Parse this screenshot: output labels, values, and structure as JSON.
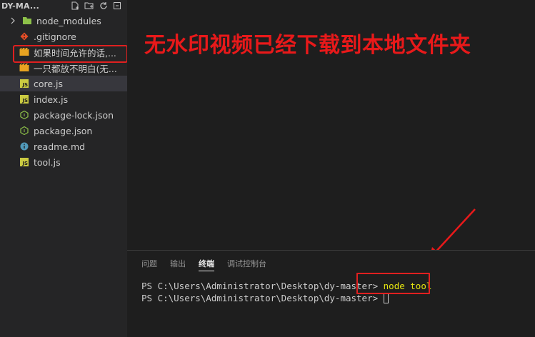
{
  "sidebar": {
    "title": "DY-MA...",
    "items": [
      {
        "label": "node_modules",
        "icon": "folder-icon",
        "type": "folder"
      },
      {
        "label": ".gitignore",
        "icon": "git-icon"
      },
      {
        "label": "如果时间允许的话,...",
        "icon": "video-file-icon"
      },
      {
        "label": "一只都放不明白(无...",
        "icon": "video-file-icon"
      },
      {
        "label": "core.js",
        "icon": "js-file-icon",
        "selected": true
      },
      {
        "label": "index.js",
        "icon": "js-file-icon"
      },
      {
        "label": "package-lock.json",
        "icon": "json-file-icon"
      },
      {
        "label": "package.json",
        "icon": "json-file-icon"
      },
      {
        "label": "readme.md",
        "icon": "info-icon"
      },
      {
        "label": "tool.js",
        "icon": "js-file-icon"
      }
    ]
  },
  "annotation": {
    "headline": "无水印视频已经下载到本地文件夹",
    "color": "#e8191a"
  },
  "panel": {
    "tabs": [
      {
        "label": "问题"
      },
      {
        "label": "输出"
      },
      {
        "label": "终端",
        "active": true
      },
      {
        "label": "调试控制台"
      }
    ],
    "terminal": {
      "prompt1": "PS C:\\Users\\Administrator\\Desktop\\dy-master> ",
      "command1": "node tool",
      "prompt2": "PS C:\\Users\\Administrator\\Desktop\\dy-master> "
    }
  }
}
